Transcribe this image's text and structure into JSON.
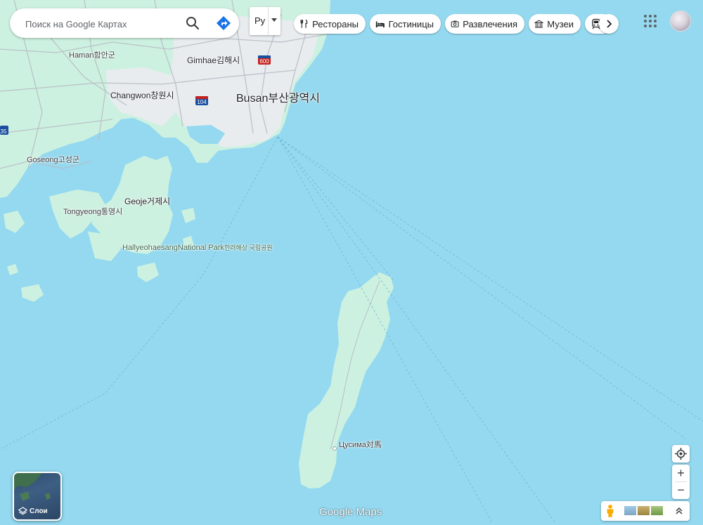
{
  "search": {
    "placeholder": "Поиск на Google Картах"
  },
  "language": {
    "current": "Ру"
  },
  "chips": [
    {
      "label": "Рестораны",
      "icon": "restaurant-icon"
    },
    {
      "label": "Гостиницы",
      "icon": "hotel-icon"
    },
    {
      "label": "Развлечения",
      "icon": "camera-icon"
    },
    {
      "label": "Музеи",
      "icon": "museum-icon"
    }
  ],
  "layers": {
    "label": "Слои"
  },
  "zoom": {
    "in": "+",
    "out": "−"
  },
  "logo": "Google Maps",
  "map": {
    "places": [
      {
        "latin": "Haman",
        "local": "함안군"
      },
      {
        "latin": "Gimhae",
        "local": "김해시"
      },
      {
        "latin": "Changwon",
        "local": "창원시"
      },
      {
        "latin": "Busan",
        "local": "부산광역시"
      },
      {
        "latin": "Goseong",
        "local": "고성군"
      },
      {
        "latin": "Tongyeong",
        "local": "통영시"
      },
      {
        "latin": "Geoje",
        "local": "거제시"
      },
      {
        "latin": "Hallyeohaesang",
        "local": "National Park",
        "extra": "한려해상 국립공원"
      },
      {
        "latin": "Цусима",
        "local": "対馬"
      }
    ],
    "shields": [
      "600",
      "104",
      "35"
    ],
    "colors": {
      "sea": "#94d9f0",
      "land": "#cdf1e0",
      "urban": "#e8ecef",
      "road": "#b8bdc6"
    }
  }
}
